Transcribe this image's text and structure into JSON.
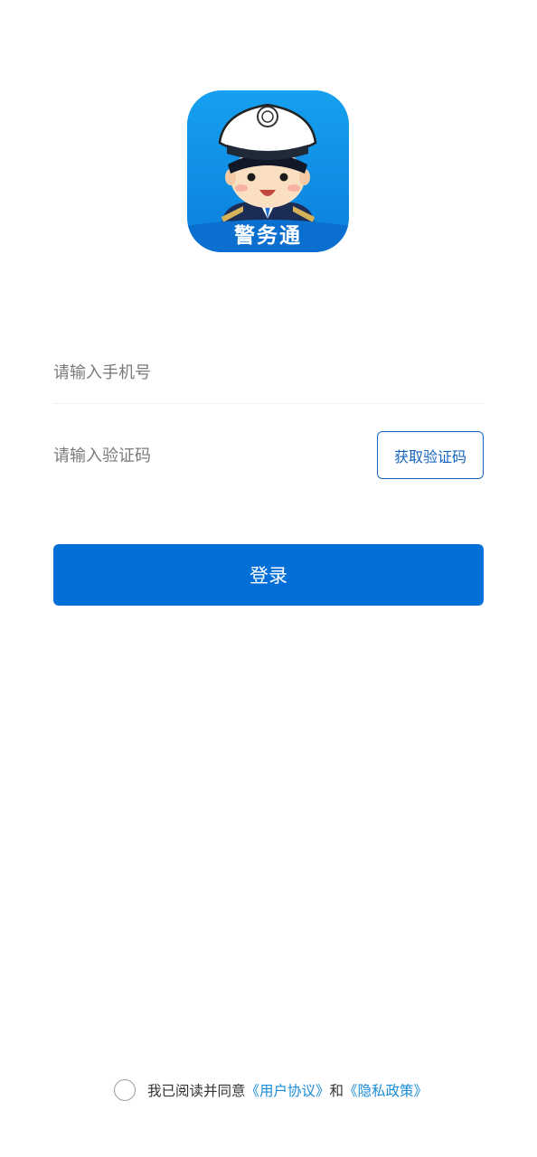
{
  "app": {
    "logo_text": "警务通",
    "logo_icon": "police-officer-mascot-icon",
    "colors": {
      "logo_blue": "#0a86e6",
      "primary": "#056fd8",
      "outline_button": "#1565c0",
      "link": "#1a8cd8"
    }
  },
  "login_form": {
    "phone_placeholder": "请输入手机号",
    "phone_value": "",
    "code_placeholder": "请输入验证码",
    "code_value": "",
    "get_code_label": "获取验证码",
    "login_label": "登录"
  },
  "agreement": {
    "checked": false,
    "prefix": "我已阅读并同意",
    "user_agreement": "《用户协议》",
    "conjunction": "和",
    "privacy_policy": "《隐私政策》"
  }
}
